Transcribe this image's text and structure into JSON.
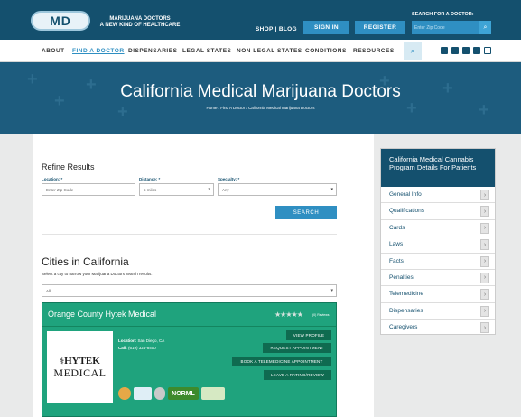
{
  "header": {
    "logo_text": "MD",
    "tagline_1": "MARIJUANA DOCTORS",
    "tagline_2": "A NEW KIND OF HEALTHCARE",
    "links": "SHOP  |  BLOG",
    "sign_in": "SIGN IN",
    "register": "REGISTER",
    "search_label": "SEARCH FOR A DOCTOR:",
    "search_placeholder": "Enter Zip Code",
    "brand_color": "#14506e",
    "accent_color": "#2f8fc2"
  },
  "nav": {
    "items": [
      "ABOUT",
      "FIND A DOCTOR",
      "DISPENSARIES",
      "LEGAL STATES",
      "NON LEGAL STATES",
      "CONDITIONS",
      "RESOURCES"
    ]
  },
  "hero": {
    "title": "California Medical Marijuana Doctors",
    "breadcrumb": "Home / Find A Doctor / California Medical Marijuana Doctors"
  },
  "refine": {
    "title": "Refine Results",
    "location_label": "Location: *",
    "location_placeholder": "Enter Zip Code",
    "distance_label": "Distance: *",
    "distance_value": "5 miles",
    "specialty_label": "Specialty: *",
    "specialty_value": "Any",
    "search_button": "SEARCH"
  },
  "cities": {
    "title": "Cities in California",
    "subtitle": "Select a city to narrow your Marijuana Doctors search results.",
    "select_value": "All"
  },
  "listing": {
    "name": "Orange County Hytek Medical",
    "reviews": "(0) Reviews",
    "rating": 0,
    "logo_line1": "HYTEK",
    "logo_line2": "MEDICAL",
    "location_label": "Location:",
    "location": "San Diego, CA",
    "call_label": "Call:",
    "phone": "(619) 324-8400",
    "buttons": [
      "VIEW PROFILE",
      "REQUEST APPOINTMENT",
      "BOOK A TELEMEDICINE APPOINTMENT",
      "LEAVE A RATING/REVIEW"
    ],
    "badge_norml": "NORML",
    "card_color": "#1fa37d"
  },
  "sidebar": {
    "title": "California Medical Cannabis Program Details For Patients",
    "items": [
      "General Info",
      "Qualifications",
      "Cards",
      "Laws",
      "Facts",
      "Penalties",
      "Telemedicine",
      "Dispensaries",
      "Caregivers"
    ]
  }
}
